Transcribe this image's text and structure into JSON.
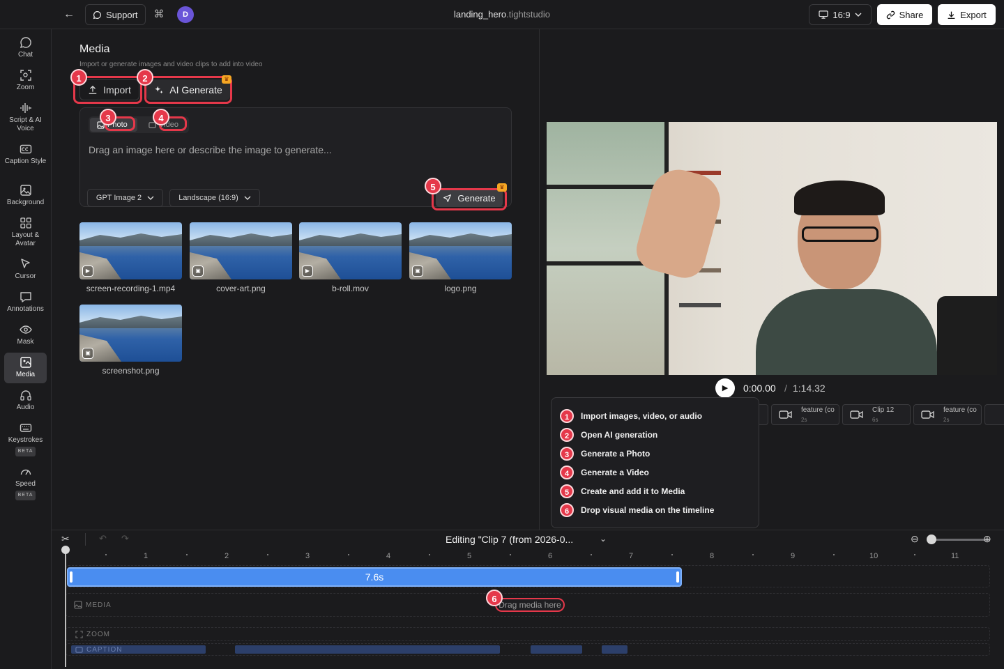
{
  "topbar": {
    "support_label": "Support",
    "avatar_initial": "D",
    "project_name": "landing_hero",
    "project_ext": ".tightstudio",
    "aspect_ratio": "16:9",
    "share_label": "Share",
    "export_label": "Export"
  },
  "sidebar": {
    "items": [
      {
        "label": "Chat",
        "icon": "chat-icon"
      },
      {
        "label": "Zoom",
        "icon": "zoom-icon"
      },
      {
        "label": "Script & AI Voice",
        "icon": "waveform-icon"
      },
      {
        "label": "Caption Style",
        "icon": "caption-icon"
      },
      {
        "label": "Background",
        "icon": "image-icon"
      },
      {
        "label": "Layout & Avatar",
        "icon": "grid-icon"
      },
      {
        "label": "Cursor",
        "icon": "cursor-icon"
      },
      {
        "label": "Annotations",
        "icon": "annotation-icon"
      },
      {
        "label": "Mask",
        "icon": "eye-icon"
      },
      {
        "label": "Media",
        "icon": "media-icon",
        "active": true
      },
      {
        "label": "Audio",
        "icon": "headphones-icon"
      },
      {
        "label": "Keystrokes",
        "icon": "keyboard-icon",
        "badge": "BETA"
      },
      {
        "label": "Speed",
        "icon": "speed-icon",
        "badge": "BETA"
      }
    ]
  },
  "media": {
    "title": "Media",
    "subtitle": "Import or generate images and video clips to add into video",
    "import_label": "Import",
    "ai_generate_label": "AI Generate",
    "photo_tab": "Photo",
    "video_tab": "Video",
    "prompt_placeholder": "Drag an image here or describe the image to generate...",
    "model_select": "GPT Image 2",
    "aspect_select": "Landscape (16:9)",
    "generate_label": "Generate",
    "items": [
      {
        "name": "screen-recording-1.mp4",
        "kind": "video"
      },
      {
        "name": "cover-art.png",
        "kind": "image"
      },
      {
        "name": "b-roll.mov",
        "kind": "video"
      },
      {
        "name": "logo.png",
        "kind": "image"
      },
      {
        "name": "screenshot.png",
        "kind": "image"
      }
    ]
  },
  "annotations": {
    "badges": [
      "1",
      "2",
      "3",
      "4",
      "5",
      "6"
    ],
    "legend": [
      {
        "num": "1",
        "text": "Import images, video, or audio"
      },
      {
        "num": "2",
        "text": "Open AI generation"
      },
      {
        "num": "3",
        "text": "Generate a Photo"
      },
      {
        "num": "4",
        "text": "Generate a Video"
      },
      {
        "num": "5",
        "text": "Create and add it to Media"
      },
      {
        "num": "6",
        "text": "Drop visual media on the timeline"
      }
    ]
  },
  "player": {
    "current_time": "0:00.00",
    "separator": "/",
    "total_time": "1:14.32"
  },
  "clips": [
    {
      "name": "feature (co",
      "duration": "2s"
    },
    {
      "name": "Clip 12",
      "duration": "6s"
    },
    {
      "name": "feature (co",
      "duration": "2s"
    }
  ],
  "timeline": {
    "editing_label": "Editing \"Clip 7 (from 2026-0...",
    "ruler": [
      "1",
      "2",
      "3",
      "4",
      "5",
      "6",
      "7",
      "8",
      "9",
      "10",
      "11"
    ],
    "clip_duration": "7.6s",
    "media_track_label": "MEDIA",
    "drop_hint": "Drag media here",
    "zoom_track_label": "ZOOM",
    "caption_track_label": "CAPTION"
  },
  "colors": {
    "accent_red": "#e5384a",
    "clip_blue": "#4a8df0",
    "background": "#1b1b1d",
    "avatar": "#6a55d8"
  }
}
